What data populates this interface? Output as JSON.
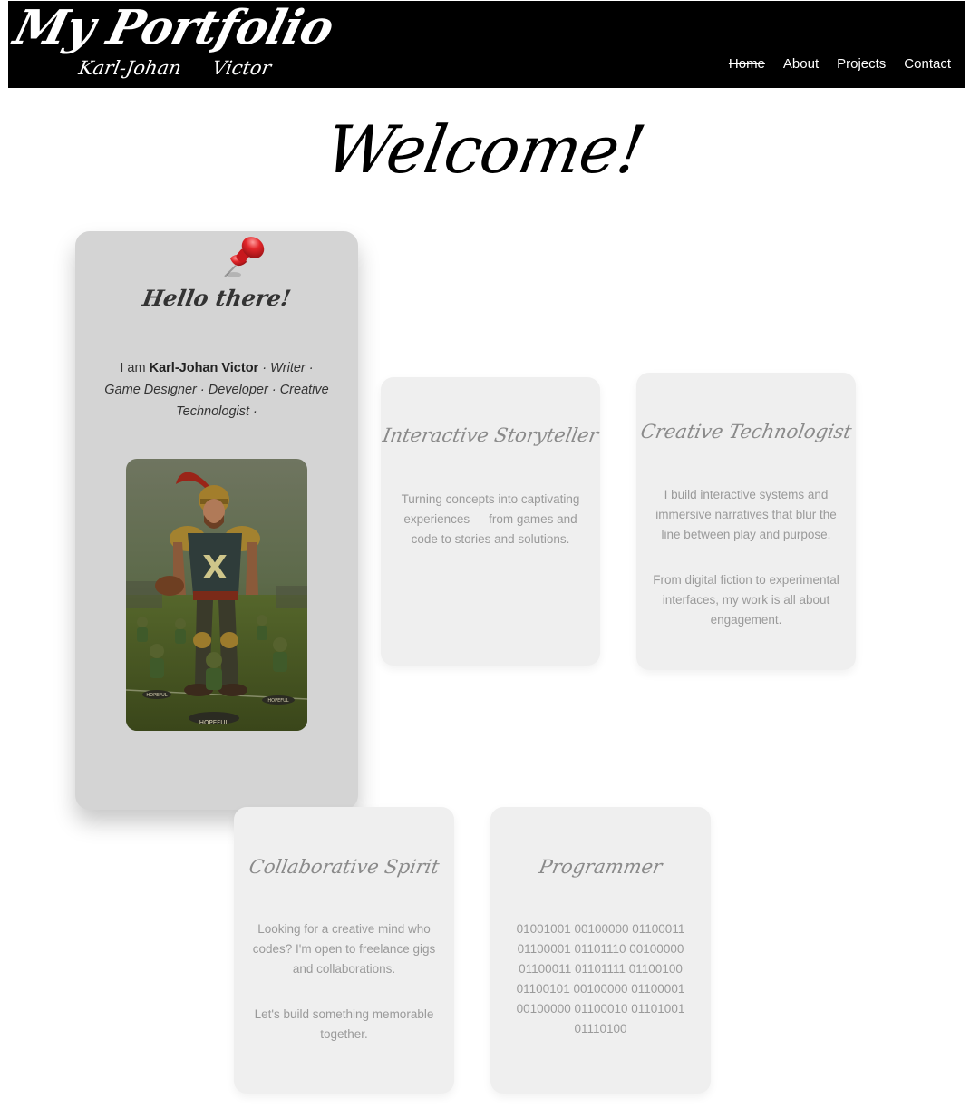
{
  "header": {
    "logo_title": "My Portfolio",
    "logo_subtitle": "Karl-Johan Victor",
    "nav": [
      {
        "label": "Home",
        "active": true
      },
      {
        "label": "About",
        "active": false
      },
      {
        "label": "Projects",
        "active": false
      },
      {
        "label": "Contact",
        "active": false
      }
    ]
  },
  "welcome": "Welcome!",
  "intro": {
    "title": "Hello there!",
    "prefix": "I am ",
    "name": "Karl-Johan Victor",
    "roles": " · Writer · Game Designer · Developer · Creative Technologist ·",
    "image_alt": "illustrated armored warrior football player with small helmeted figures labeled HOPEFUL",
    "image_labels": [
      "HOPEFUL",
      "HOPEFUL",
      "HOPEFUL"
    ]
  },
  "cards": [
    {
      "title": "Interactive Storyteller",
      "paragraphs": [
        "Turning concepts into captivating experiences — from games and code to stories and solutions."
      ]
    },
    {
      "title": "Creative Technologist",
      "paragraphs": [
        "I build interactive systems and immersive narratives that blur the line between play and purpose.",
        "From digital fiction to experimental interfaces, my work is all about engagement."
      ]
    },
    {
      "title": "Collaborative Spirit",
      "paragraphs": [
        "Looking for a creative mind who codes? I'm open to freelance gigs and collaborations.",
        "Let's build something memorable together."
      ]
    },
    {
      "title": "Programmer",
      "paragraphs": [
        "01001001 00100000 01100011 01100001 01101110 00100000 01100011 01101111 01100100 01100101 00100000 01100001 00100000 01100010 01101001 01110100"
      ]
    }
  ],
  "colors": {
    "header_bg": "#000000",
    "intro_card_bg": "#d4d4d4",
    "card_bg": "#efefef",
    "muted_text": "#9a9a9a"
  }
}
